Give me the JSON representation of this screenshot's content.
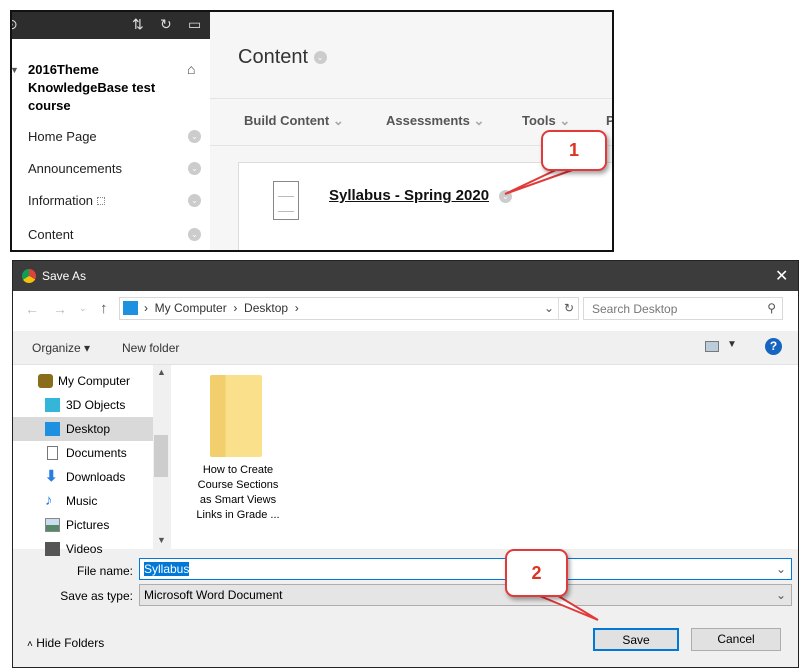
{
  "lms": {
    "sidebar": {
      "course_title": "2016Theme KnowledgeBase test course",
      "items": [
        {
          "label": "Home Page"
        },
        {
          "label": "Announcements"
        },
        {
          "label": "Information"
        },
        {
          "label": "Content"
        }
      ]
    },
    "page_title": "Content",
    "toolbar": [
      "Build Content",
      "Assessments",
      "Tools",
      "P"
    ],
    "item_link": "Syllabus - Spring 2020"
  },
  "callouts": [
    "1",
    "2"
  ],
  "dialog": {
    "title": "Save As",
    "breadcrumb": [
      "My Computer",
      "Desktop"
    ],
    "search_placeholder": "Search Desktop",
    "organize": "Organize",
    "new_folder": "New folder",
    "nav": [
      {
        "label": "My Computer",
        "icon": "computer-icon"
      },
      {
        "label": "3D Objects",
        "icon": "cube-icon"
      },
      {
        "label": "Desktop",
        "icon": "desktop-icon",
        "selected": true
      },
      {
        "label": "Documents",
        "icon": "document-icon"
      },
      {
        "label": "Downloads",
        "icon": "download-icon"
      },
      {
        "label": "Music",
        "icon": "music-icon"
      },
      {
        "label": "Pictures",
        "icon": "pictures-icon"
      },
      {
        "label": "Videos",
        "icon": "video-icon"
      }
    ],
    "folder": "How to Create Course Sections as Smart Views Links in Grade ...",
    "file_name_label": "File name:",
    "file_name": "Syllabus",
    "type_label": "Save as type:",
    "type": "Microsoft Word Document",
    "hide_folders": "Hide Folders",
    "save": "Save",
    "cancel": "Cancel"
  }
}
